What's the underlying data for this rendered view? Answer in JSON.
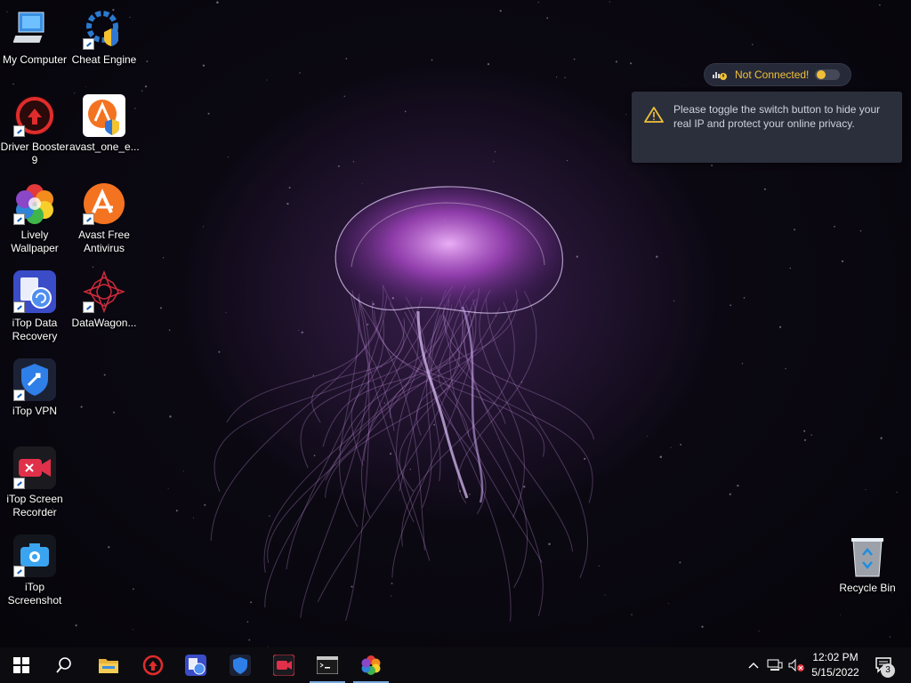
{
  "desktop": {
    "icons": [
      {
        "id": "my-computer",
        "label": "My Computer"
      },
      {
        "id": "cheat-engine",
        "label": "Cheat Engine"
      },
      {
        "id": "driver-booster",
        "label": "Driver Booster 9"
      },
      {
        "id": "avast-one",
        "label": "avast_one_e..."
      },
      {
        "id": "lively-wallpaper",
        "label": "Lively Wallpaper"
      },
      {
        "id": "avast-free",
        "label": "Avast Free Antivirus"
      },
      {
        "id": "itop-data-recovery",
        "label": "iTop Data Recovery"
      },
      {
        "id": "datawagon",
        "label": "DataWagon..."
      },
      {
        "id": "itop-vpn",
        "label": "iTop VPN"
      },
      {
        "id": "itop-screen-recorder",
        "label": "iTop Screen Recorder"
      },
      {
        "id": "itop-screenshot",
        "label": "iTop Screenshot"
      },
      {
        "id": "recycle-bin",
        "label": "Recycle Bin"
      }
    ]
  },
  "vpn_widget": {
    "status_text": "Not Connected!",
    "status_color": "#f0c038",
    "tooltip_message": "Please toggle the switch button to hide your real IP and protect your online privacy.",
    "warning_icon": "warning-triangle-icon"
  },
  "taskbar": {
    "buttons": [
      {
        "id": "start",
        "icon": "windows-logo-icon"
      },
      {
        "id": "search",
        "icon": "search-icon"
      },
      {
        "id": "file-explorer",
        "icon": "folder-icon"
      },
      {
        "id": "driver-booster",
        "icon": "driver-booster-icon"
      },
      {
        "id": "itop-data-recovery",
        "icon": "data-recovery-icon"
      },
      {
        "id": "itop-vpn",
        "icon": "vpn-shield-icon"
      },
      {
        "id": "itop-screen-recorder",
        "icon": "screen-recorder-icon"
      },
      {
        "id": "command-prompt",
        "icon": "terminal-icon",
        "active": true
      },
      {
        "id": "lively-wallpaper",
        "icon": "lively-flower-icon",
        "active": true
      }
    ],
    "tray": {
      "time": "12:02 PM",
      "date": "5/15/2022",
      "notification_count": "3"
    }
  },
  "colors": {
    "accent": "#79a8de",
    "warning": "#f0c038",
    "tooltip_bg": "#2b2f3c"
  }
}
